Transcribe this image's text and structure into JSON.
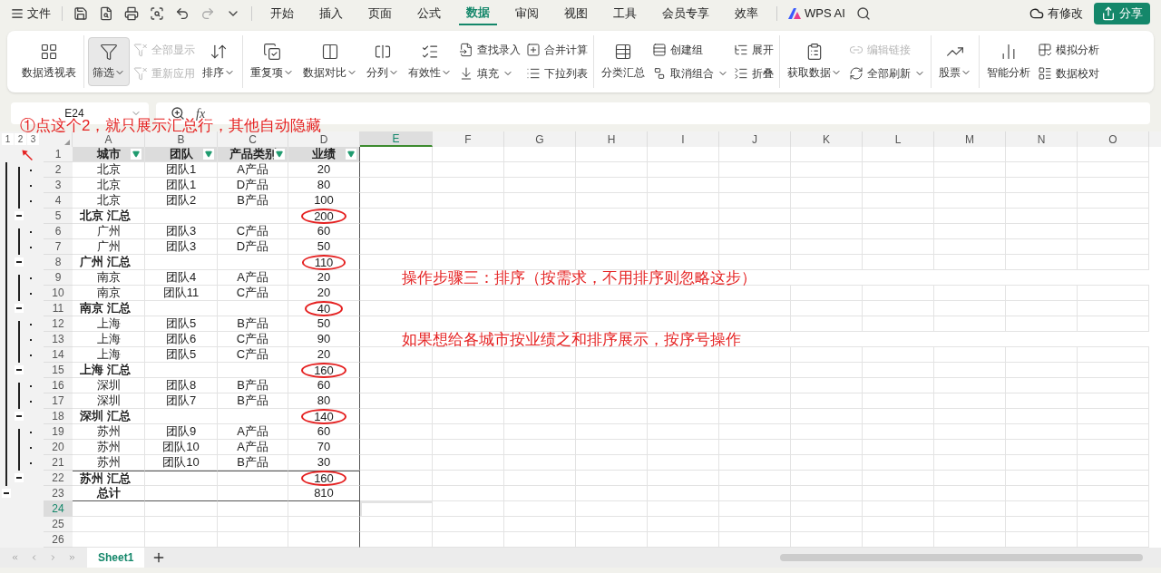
{
  "title_bar": {
    "file_menu": "文件",
    "tabs": [
      {
        "label": "开始",
        "selected": false
      },
      {
        "label": "插入",
        "selected": false
      },
      {
        "label": "页面",
        "selected": false
      },
      {
        "label": "公式",
        "selected": false
      },
      {
        "label": "数据",
        "selected": true
      },
      {
        "label": "审阅",
        "selected": false
      },
      {
        "label": "视图",
        "selected": false
      },
      {
        "label": "工具",
        "selected": false
      },
      {
        "label": "会员专享",
        "selected": false
      },
      {
        "label": "效率",
        "selected": false
      }
    ],
    "ai_button": "WPS AI",
    "status": "有修改",
    "share_button": "分享"
  },
  "ribbon": {
    "groups": [
      {
        "items": [
          {
            "kind": "large",
            "label": "数据透视表",
            "dropdown": false,
            "pressed": false
          }
        ]
      },
      {
        "items": [
          {
            "kind": "large",
            "label": "筛选",
            "dropdown": true,
            "pressed": true
          },
          {
            "kind": "stack",
            "entries": [
              {
                "label": "全部显示",
                "dropdown": false,
                "disabled": true
              },
              {
                "label": "重新应用",
                "dropdown": false,
                "disabled": true
              }
            ]
          },
          {
            "kind": "large",
            "label": "排序",
            "dropdown": true,
            "pressed": false
          }
        ]
      },
      {
        "items": [
          {
            "kind": "large",
            "label": "重复项",
            "dropdown": true,
            "pressed": false
          },
          {
            "kind": "large",
            "label": "数据对比",
            "dropdown": true,
            "pressed": false
          },
          {
            "kind": "large",
            "label": "分列",
            "dropdown": true,
            "pressed": false
          },
          {
            "kind": "large",
            "label": "有效性",
            "dropdown": true,
            "pressed": false
          },
          {
            "kind": "stack",
            "entries": [
              {
                "label": "查找录入",
                "dropdown": false,
                "disabled": false
              },
              {
                "label": "填充",
                "dropdown": true,
                "disabled": false
              }
            ]
          },
          {
            "kind": "stack",
            "entries": [
              {
                "label": "合并计算",
                "dropdown": false,
                "disabled": false
              },
              {
                "label": "下拉列表",
                "dropdown": false,
                "disabled": false
              }
            ]
          }
        ]
      },
      {
        "items": [
          {
            "kind": "large",
            "label": "分类汇总",
            "dropdown": false,
            "pressed": false
          },
          {
            "kind": "stack",
            "entries": [
              {
                "label": "创建组",
                "dropdown": false,
                "disabled": false
              },
              {
                "label": "取消组合",
                "dropdown": true,
                "disabled": false
              }
            ]
          },
          {
            "kind": "stack",
            "entries": [
              {
                "label": "展开",
                "dropdown": false,
                "disabled": false
              },
              {
                "label": "折叠",
                "dropdown": false,
                "disabled": false
              }
            ]
          }
        ]
      },
      {
        "items": [
          {
            "kind": "large",
            "label": "获取数据",
            "dropdown": true,
            "pressed": false
          },
          {
            "kind": "stack",
            "entries": [
              {
                "label": "编辑链接",
                "dropdown": false,
                "disabled": true
              },
              {
                "label": "全部刷新",
                "dropdown": true,
                "disabled": false
              }
            ]
          }
        ]
      },
      {
        "items": [
          {
            "kind": "large",
            "label": "股票",
            "dropdown": true,
            "pressed": false
          }
        ]
      },
      {
        "items": [
          {
            "kind": "large",
            "label": "智能分析",
            "dropdown": false,
            "pressed": false
          },
          {
            "kind": "stack",
            "entries": [
              {
                "label": "模拟分析",
                "dropdown": false,
                "disabled": false
              },
              {
                "label": "数据校对",
                "dropdown": false,
                "disabled": false
              }
            ]
          }
        ]
      }
    ]
  },
  "formula_bar": {
    "name_box": "E24",
    "function_label": "fx"
  },
  "outline_levels": [
    {
      "label": "1",
      "selected": false
    },
    {
      "label": "2",
      "selected": false
    },
    {
      "label": "3",
      "selected": false
    }
  ],
  "columns": [
    {
      "label": "A",
      "selected": false
    },
    {
      "label": "B",
      "selected": false
    },
    {
      "label": "C",
      "selected": false
    },
    {
      "label": "D",
      "selected": false
    },
    {
      "label": "E",
      "selected": true
    },
    {
      "label": "F",
      "selected": false
    },
    {
      "label": "G",
      "selected": false
    },
    {
      "label": "H",
      "selected": false
    },
    {
      "label": "I",
      "selected": false
    },
    {
      "label": "J",
      "selected": false
    },
    {
      "label": "K",
      "selected": false
    },
    {
      "label": "L",
      "selected": false
    },
    {
      "label": "M",
      "selected": false
    },
    {
      "label": "N",
      "selected": false
    },
    {
      "label": "O",
      "selected": false
    }
  ],
  "rows": [
    {
      "number": "1",
      "kind": "header",
      "selected": false,
      "cells": [
        "城市",
        "团队",
        "产品类别",
        "业绩"
      ]
    },
    {
      "number": "2",
      "kind": "detail",
      "selected": false,
      "cells": [
        "北京",
        "团队1",
        "A产品",
        "20"
      ]
    },
    {
      "number": "3",
      "kind": "detail",
      "selected": false,
      "cells": [
        "北京",
        "团队1",
        "D产品",
        "80"
      ]
    },
    {
      "number": "4",
      "kind": "detail",
      "selected": false,
      "cells": [
        "北京",
        "团队2",
        "B产品",
        "100"
      ]
    },
    {
      "number": "5",
      "kind": "subtotal",
      "selected": false,
      "circled": true,
      "cells": [
        "北京 汇总",
        "",
        "",
        "200"
      ]
    },
    {
      "number": "6",
      "kind": "detail",
      "selected": false,
      "cells": [
        "广州",
        "团队3",
        "C产品",
        "60"
      ]
    },
    {
      "number": "7",
      "kind": "detail",
      "selected": false,
      "cells": [
        "广州",
        "团队3",
        "D产品",
        "50"
      ]
    },
    {
      "number": "8",
      "kind": "subtotal",
      "selected": false,
      "circled": true,
      "cells": [
        "广州 汇总",
        "",
        "",
        "110"
      ]
    },
    {
      "number": "9",
      "kind": "detail",
      "selected": false,
      "cells": [
        "南京",
        "团队4",
        "A产品",
        "20"
      ],
      "note": "操作步骤三：排序（按需求，不用排序则忽略这步）"
    },
    {
      "number": "10",
      "kind": "detail",
      "selected": false,
      "cells": [
        "南京",
        "团队11",
        "C产品",
        "20"
      ]
    },
    {
      "number": "11",
      "kind": "subtotal",
      "selected": false,
      "circled": true,
      "cells": [
        "南京 汇总",
        "",
        "",
        "40"
      ]
    },
    {
      "number": "12",
      "kind": "detail",
      "selected": false,
      "cells": [
        "上海",
        "团队5",
        "B产品",
        "50"
      ]
    },
    {
      "number": "13",
      "kind": "detail",
      "selected": false,
      "cells": [
        "上海",
        "团队6",
        "C产品",
        "90"
      ],
      "note": "如果想给各城市按业绩之和排序展示，按序号操作"
    },
    {
      "number": "14",
      "kind": "detail",
      "selected": false,
      "cells": [
        "上海",
        "团队5",
        "C产品",
        "20"
      ]
    },
    {
      "number": "15",
      "kind": "subtotal",
      "selected": false,
      "circled": true,
      "cells": [
        "上海 汇总",
        "",
        "",
        "160"
      ]
    },
    {
      "number": "16",
      "kind": "detail",
      "selected": false,
      "cells": [
        "深圳",
        "团队8",
        "B产品",
        "60"
      ]
    },
    {
      "number": "17",
      "kind": "detail",
      "selected": false,
      "cells": [
        "深圳",
        "团队7",
        "B产品",
        "80"
      ]
    },
    {
      "number": "18",
      "kind": "subtotal",
      "selected": false,
      "circled": true,
      "cells": [
        "深圳 汇总",
        "",
        "",
        "140"
      ]
    },
    {
      "number": "19",
      "kind": "detail",
      "selected": false,
      "cells": [
        "苏州",
        "团队9",
        "A产品",
        "60"
      ]
    },
    {
      "number": "20",
      "kind": "detail",
      "selected": false,
      "cells": [
        "苏州",
        "团队10",
        "A产品",
        "70"
      ]
    },
    {
      "number": "21",
      "kind": "detail",
      "selected": false,
      "cells": [
        "苏州",
        "团队10",
        "B产品",
        "30"
      ]
    },
    {
      "number": "22",
      "kind": "subtotal",
      "selected": false,
      "circled": true,
      "cells": [
        "苏州 汇总",
        "",
        "",
        "160"
      ]
    },
    {
      "number": "23",
      "kind": "total",
      "selected": false,
      "circled": false,
      "cells": [
        "总计",
        "",
        "",
        "810"
      ]
    },
    {
      "number": "24",
      "kind": "empty",
      "selected": true,
      "cells": []
    },
    {
      "number": "25",
      "kind": "empty",
      "selected": false,
      "cells": []
    },
    {
      "number": "26",
      "kind": "empty",
      "selected": false,
      "cells": []
    }
  ],
  "annotations": [
    "①点这个2，就只展示汇总行，其他自动隐藏"
  ],
  "sheet_tabs": [
    {
      "label": "Sheet1",
      "selected": true
    }
  ]
}
